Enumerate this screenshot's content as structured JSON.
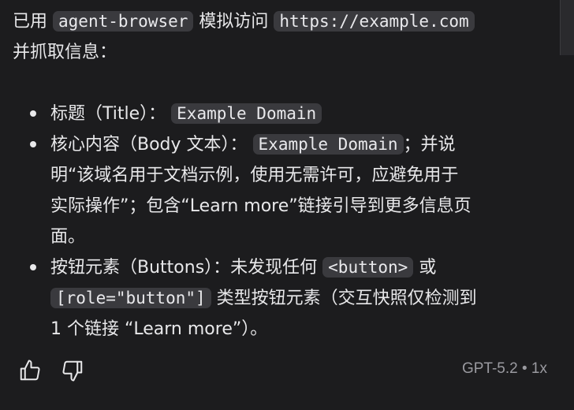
{
  "intro": {
    "prefix": "已用",
    "tool": "agent-browser",
    "middle": "模拟访问",
    "url": "https://example.com",
    "suffix": "并抓取信息："
  },
  "items": [
    {
      "label": "标题（Title）：",
      "code": "Example Domain",
      "after": ""
    },
    {
      "label": "核心内容（Body 文本）：",
      "code": "Example Domain",
      "after_line1": "；并说",
      "after_line2": "明“该域名用于文档示例，使用无需许可，应避免用于",
      "after_line3": "实际操作”；包含“Learn more”链接引导到更多信息页",
      "after_line4": "面。"
    },
    {
      "label": "按钮元素（Buttons）：未发现任何",
      "code1": "<button>",
      "mid": "或",
      "code2": "[role=\"button\"]",
      "after_line2": "类型按钮元素（交互快照仅检测到",
      "after_line3": "1 个链接 “Learn more”）。"
    }
  ],
  "footer": {
    "thumbs_up_icon": "thumbs-up-icon",
    "thumbs_down_icon": "thumbs-down-icon",
    "meta": "GPT-5.2 • 1x"
  },
  "colors": {
    "background": "#1c1c1e",
    "text": "#e8e8ea",
    "code_bg": "#3a3a3e",
    "muted": "#9a9aa0"
  }
}
